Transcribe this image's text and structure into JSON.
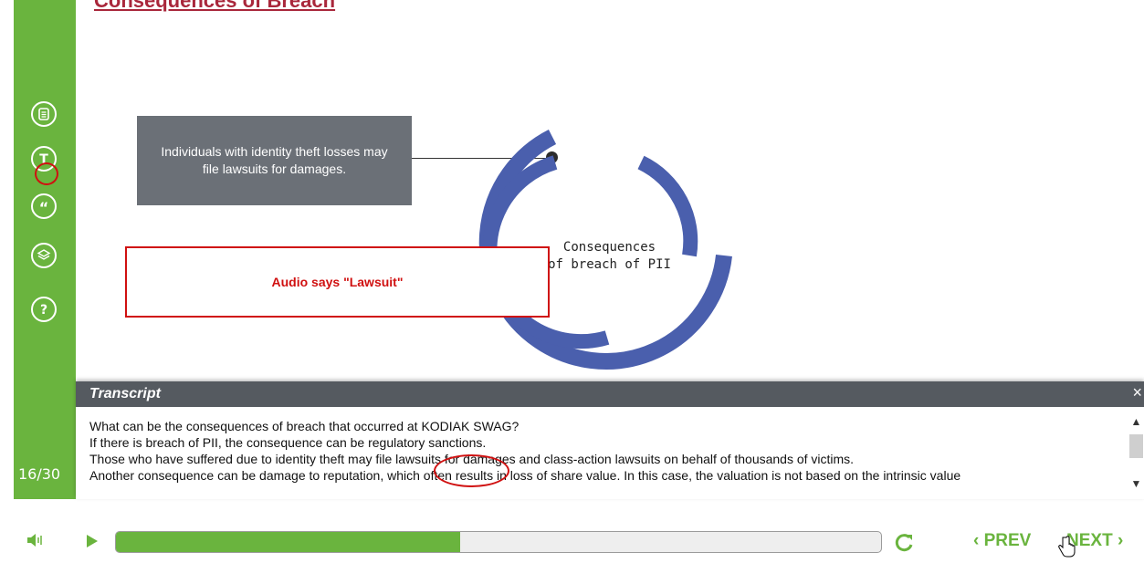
{
  "slide": {
    "title": "Consequences of Breach"
  },
  "callout": {
    "text": "Individuals with identity theft losses may file lawsuits for damages."
  },
  "diagram": {
    "center_label_line1": "Consequences",
    "center_label_line2": "of breach of PII"
  },
  "annotation": {
    "text": "Audio says \"Lawsuit\""
  },
  "sidebar": {
    "page_counter": "16/30",
    "icons": [
      "notes-icon",
      "text-icon",
      "quote-icon",
      "layers-icon",
      "help-icon"
    ]
  },
  "transcript": {
    "title": "Transcript",
    "close": "×",
    "lines": [
      "What can be the consequences of breach that occurred at KODIAK SWAG?",
      "If there is breach of PII, the consequence can be regulatory sanctions.",
      "Those who have suffered due to identity theft may file lawsuits for damages and class-action lawsuits on behalf of thousands of victims.",
      "Another consequence can be damage to reputation, which often results in loss of share value. In this case, the valuation is not based on the intrinsic value"
    ]
  },
  "player": {
    "progress_fraction": 0.45,
    "prev_label": "PREV",
    "next_label": "NEXT",
    "accent_color": "#6ab43e"
  }
}
